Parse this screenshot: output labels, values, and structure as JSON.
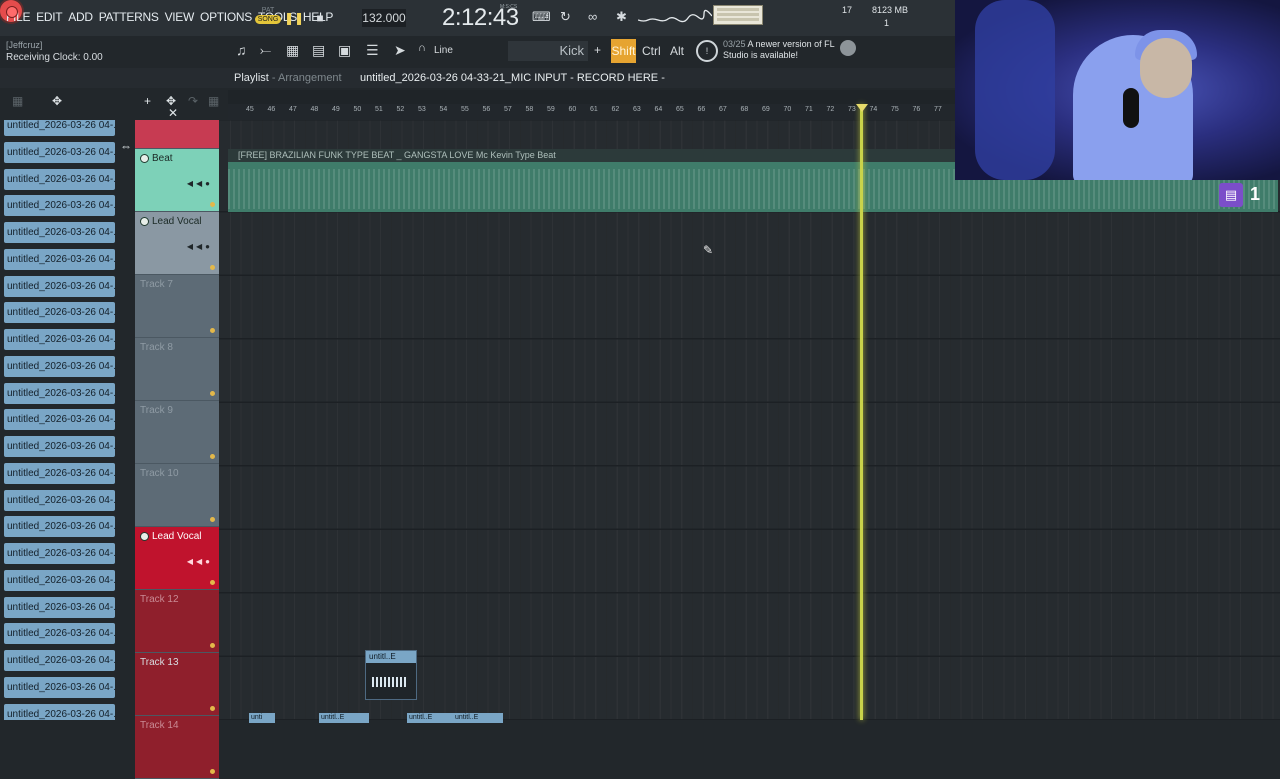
{
  "menu": [
    "FILE",
    "EDIT",
    "ADD",
    "PATTERNS",
    "VIEW",
    "OPTIONS",
    "TOOLS",
    "HELP"
  ],
  "transport": {
    "pat_label": "PAT",
    "song_label": "SONG",
    "tempo": "132.000",
    "time": "2:12:43",
    "time_unit": "M:S:CS",
    "cpu": "17",
    "memory": "8123 MB",
    "polyphony": "1"
  },
  "info": {
    "user": "[Jeffcruz]",
    "status": "Receiving Clock: 0.00"
  },
  "toolbar2": {
    "snap": "Line",
    "channel": "Kick",
    "plus": "+",
    "shift": "Shift",
    "ctrl": "Ctrl",
    "alt": "Alt",
    "hint_date": "03/25",
    "hint_text": "A newer version of FL Studio is available!"
  },
  "playlist": {
    "title": "Playlist",
    "subtitle": "- Arrangement",
    "filename": "untitled_2026-03-26 04-33-21_MIC INPUT - RECORD HERE -"
  },
  "ruler_ticks": [
    "45",
    "46",
    "47",
    "48",
    "49",
    "50",
    "51",
    "52",
    "53",
    "54",
    "55",
    "56",
    "57",
    "58",
    "59",
    "60",
    "61",
    "62",
    "63",
    "64",
    "65",
    "66",
    "67",
    "68",
    "69",
    "70",
    "71",
    "72",
    "73",
    "74",
    "75",
    "76",
    "77"
  ],
  "picker": {
    "item_label": "untitled_2026-03-26 04-...",
    "count": 23
  },
  "tracks": [
    {
      "name": "Beat",
      "active": true,
      "color": "#7dd1b8"
    },
    {
      "name": "Lead Vocal",
      "active": true,
      "color": "#8a98a3"
    },
    {
      "name": "Track 7",
      "active": false,
      "color": "#5d6b76"
    },
    {
      "name": "Track 8",
      "active": false,
      "color": "#5d6b76"
    },
    {
      "name": "Track 9",
      "active": false,
      "color": "#5d6b76"
    },
    {
      "name": "Track 10",
      "active": false,
      "color": "#5d6b76"
    },
    {
      "name": "Lead Vocal",
      "active": true,
      "color": "#c0132d"
    },
    {
      "name": "Track 12",
      "active": false,
      "color": "#8f1f2c"
    },
    {
      "name": "Track 13",
      "active": false,
      "color": "#8f1f2c"
    },
    {
      "name": "Track 14",
      "active": false,
      "color": "#8f1f2c"
    }
  ],
  "clips": {
    "beat_title": "[FREE] BRAZILIAN FUNK TYPE BEAT _ GANGSTA LOVE Mc Kevin Type Beat",
    "small_clip": "untitl..E",
    "mini1": "unti",
    "mini2": "untitl..E",
    "mini3": "untitl..E",
    "mini4": "untitl..E"
  },
  "stream": {
    "viewers": "1"
  }
}
